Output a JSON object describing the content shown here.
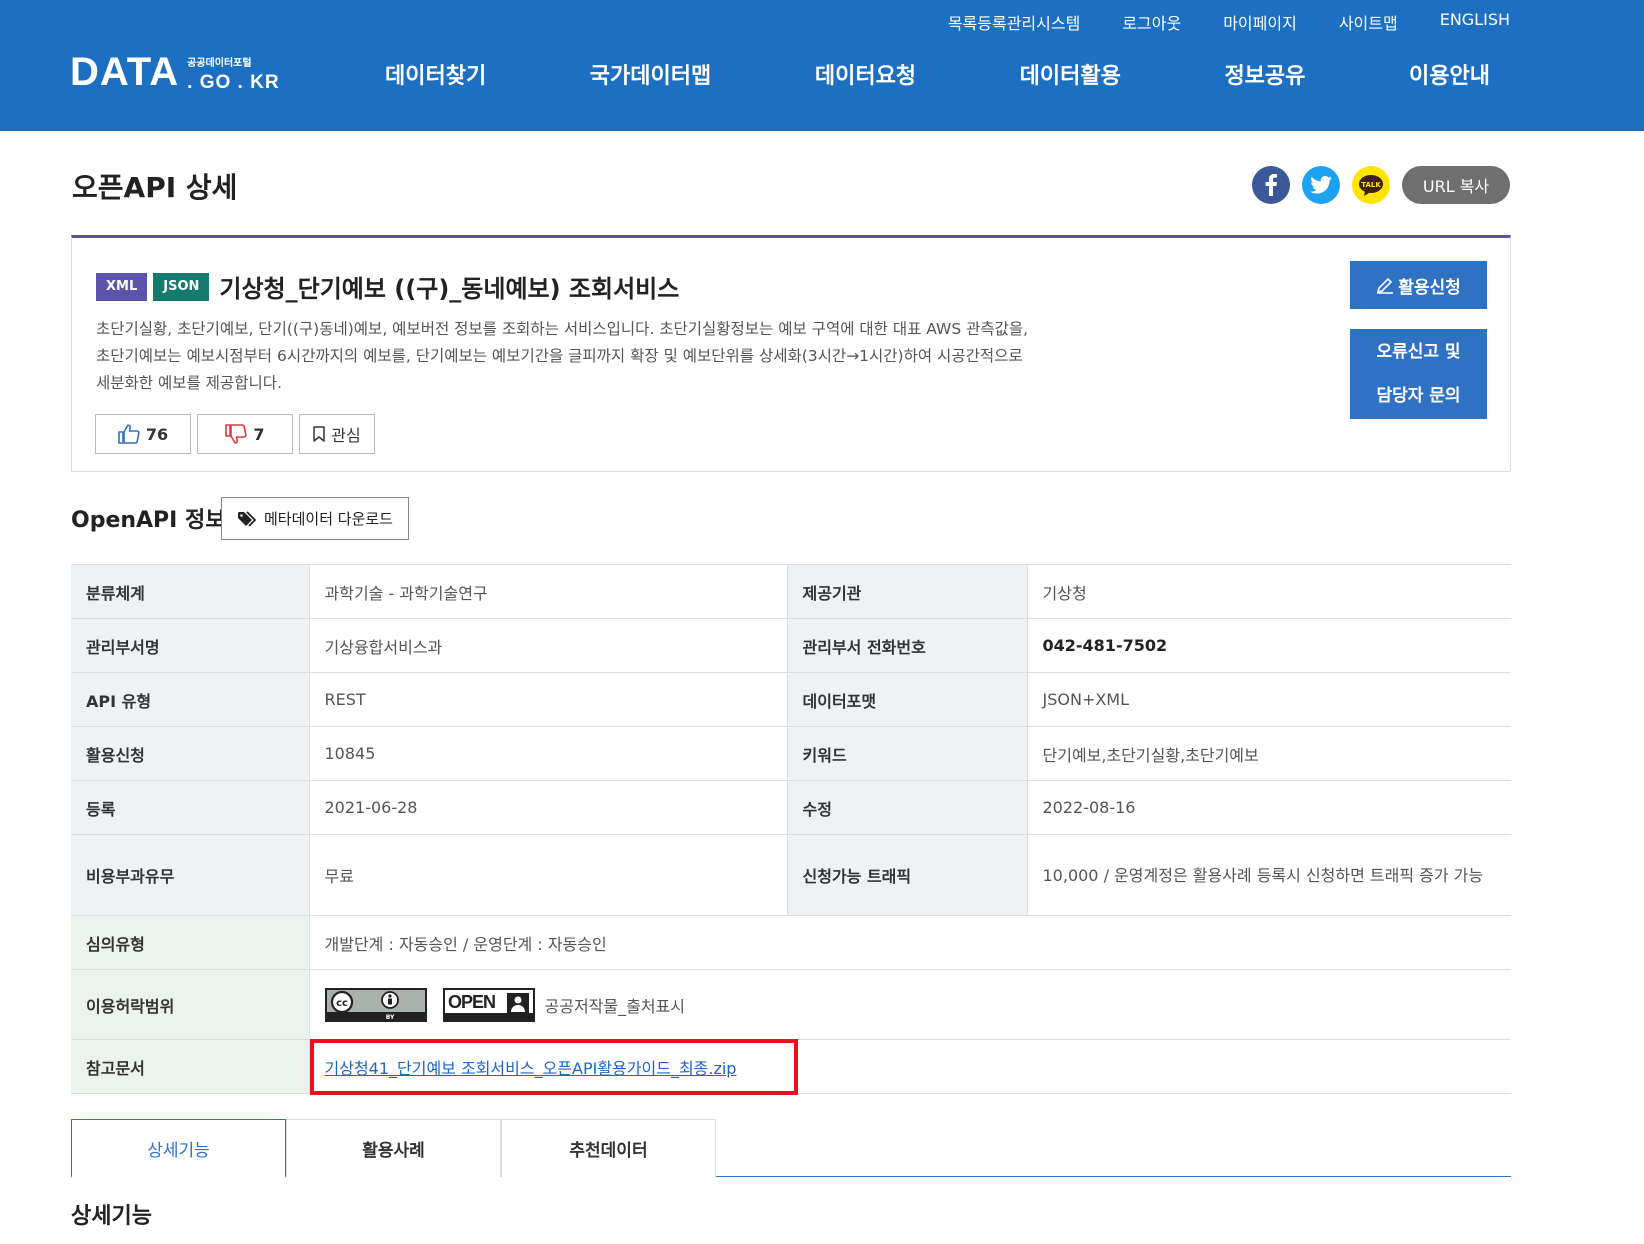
{
  "header": {
    "util_nav": [
      "목록등록관리시스템",
      "로그아웃",
      "마이페이지",
      "사이트맵",
      "ENGLISH"
    ],
    "logo_main": "DATA",
    "logo_kr": "공공데이터포털",
    "logo_domain": ". GO . KR",
    "gnb": [
      "데이터찾기",
      "국가데이터맵",
      "데이터요청",
      "데이터활용",
      "정보공유",
      "이용안내"
    ]
  },
  "page": {
    "title": "오픈API 상세",
    "url_copy": "URL 복사",
    "share_icons": [
      "facebook-icon",
      "twitter-icon",
      "kakaotalk-icon"
    ]
  },
  "summary": {
    "tags": [
      "XML",
      "JSON"
    ],
    "title": "기상청_단기예보 ((구)_동네예보) 조회서비스",
    "description_lines": [
      "초단기실황, 초단기예보, 단기((구)동네)예보, 예보버전 정보를 조회하는 서비스입니다. 초단기실황정보는 예보 구역에 대한 대표 AWS 관측값을,",
      "초단기예보는 예보시점부터 6시간까지의 예보를, 단기예보는 예보기간을 글피까지 확장 및 예보단위를 상세화(3시간→1시간)하여 시공간적으로",
      "세분화한 예보를 제공합니다."
    ],
    "likes": "76",
    "dislikes": "7",
    "favorite": "관심",
    "apply_button": "활용신청",
    "error_button_line1": "오류신고 및",
    "error_button_line2": "담당자 문의"
  },
  "openapi_info": {
    "title": "OpenAPI 정보",
    "metadata_button": "메타데이터 다운로드",
    "rows": {
      "category_label": "분류체계",
      "category_value": "과학기술 - 과학기술연구",
      "provider_label": "제공기관",
      "provider_value": "기상청",
      "dept_label": "관리부서명",
      "dept_value": "기상융합서비스과",
      "phone_label": "관리부서 전화번호",
      "phone_value": "042-481-7502",
      "api_type_label": "API 유형",
      "api_type_value": "REST",
      "format_label": "데이터포맷",
      "format_value": "JSON+XML",
      "apply_label": "활용신청",
      "apply_value": "10845",
      "keyword_label": "키워드",
      "keyword_value": "단기예보,초단기실황,초단기예보",
      "registered_label": "등록",
      "registered_value": "2021-06-28",
      "modified_label": "수정",
      "modified_value": "2022-08-16",
      "cost_label": "비용부과유무",
      "cost_value": "무료",
      "traffic_label": "신청가능 트래픽",
      "traffic_value": "10,000 / 운영계정은 활용사례 등록시 신청하면 트래픽 증가 가능",
      "review_label": "심의유형",
      "review_value": "개발단계 : 자동승인 / 운영단계 : 자동승인",
      "license_label": "이용허락범위",
      "license_value": "공공저작물_출처표시",
      "doc_label": "참고문서",
      "doc_value": "기상청41_단기예보 조회서비스_오픈API활용가이드_최종.zip"
    },
    "license_badges": [
      "cc-by-badge",
      "kogl-open-badge"
    ]
  },
  "tabs": [
    "상세기능",
    "활용사례",
    "추천데이터"
  ],
  "sub_title": "상세기능",
  "colors": {
    "header_bg": "#1d6fc1",
    "button_blue": "#2f72c4",
    "xml_tag": "#5a55a8",
    "json_tag": "#167a6e",
    "highlight_red": "#e8121d",
    "link": "#1e66c7"
  }
}
